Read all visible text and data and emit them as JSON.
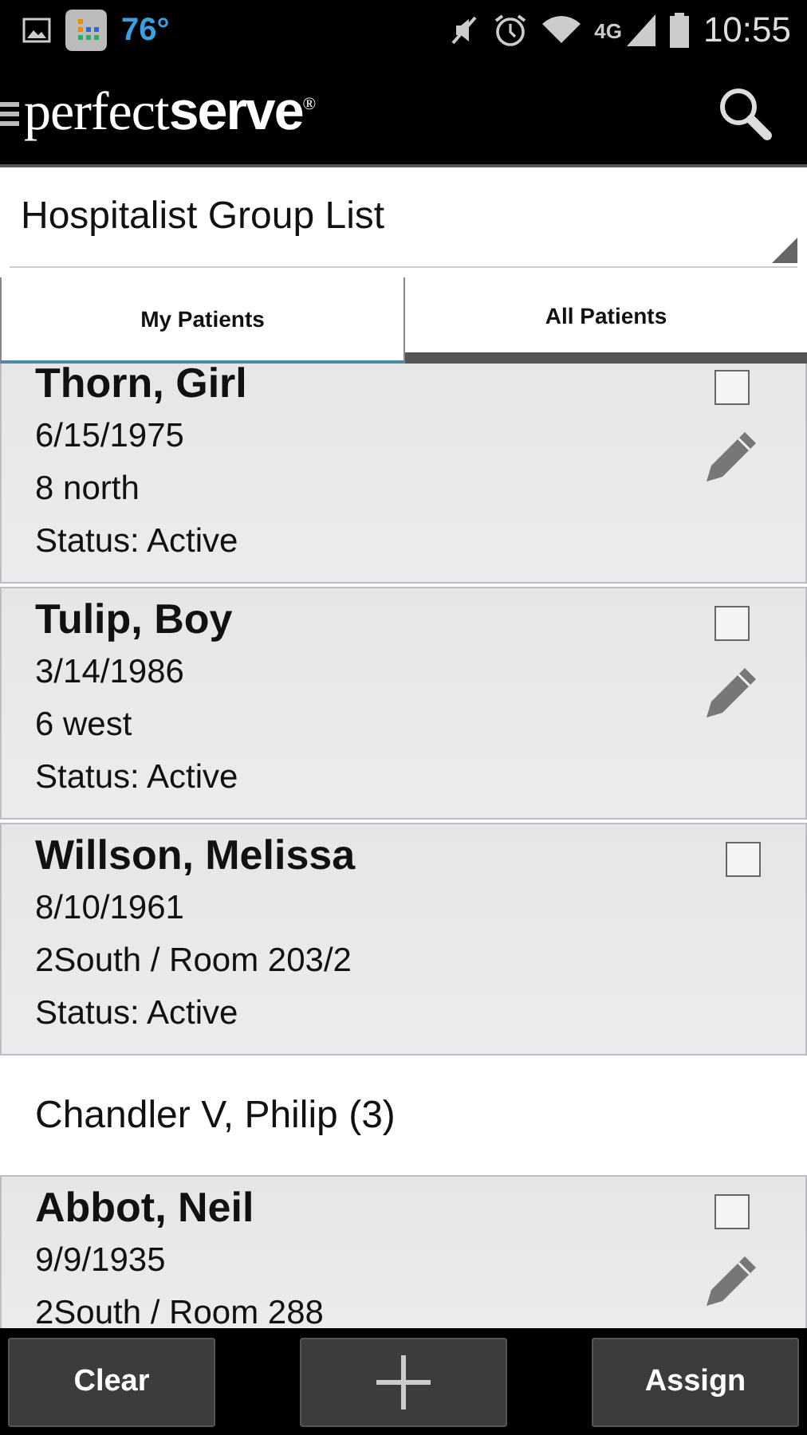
{
  "status_bar": {
    "temperature": "76°",
    "network": "4G",
    "time": "10:55"
  },
  "app_bar": {
    "logo": "perfect**serve**$^{®}$"
  },
  "group_selector": {
    "value": "Hospitalist Group List"
  },
  "tabs": [
    {
      "label": "My Patients",
      "selected": true
    },
    {
      "label": "All Patients",
      "selected": false
    }
  ],
  "list": [
    {
      "kind": "patient",
      "name": "Thorn, Girl",
      "dob": "6/15/1975",
      "location": "8 north",
      "status": "Status: Active",
      "checked": false,
      "editable": true
    },
    {
      "kind": "patient",
      "name": "Tulip, Boy",
      "dob": "3/14/1986",
      "location": "6 west",
      "status": "Status: Active",
      "checked": false,
      "editable": true
    },
    {
      "kind": "patient",
      "name": "Willson, Melissa",
      "dob": "8/10/1961",
      "location": "2South / Room 203/2",
      "status": "Status: Active",
      "checked": false,
      "editable": false
    },
    {
      "kind": "group",
      "name": "Chandler V, Philip (3)"
    },
    {
      "kind": "patient",
      "name": "Abbot, Neil",
      "dob": "9/9/1935",
      "location": "2South / Room 288",
      "checked": false,
      "editable": true
    }
  ],
  "buttons": [
    {
      "kind": "text",
      "label": "Clear"
    },
    {
      "kind": "add"
    },
    {
      "kind": "text",
      "label": "Assign"
    }
  ]
}
